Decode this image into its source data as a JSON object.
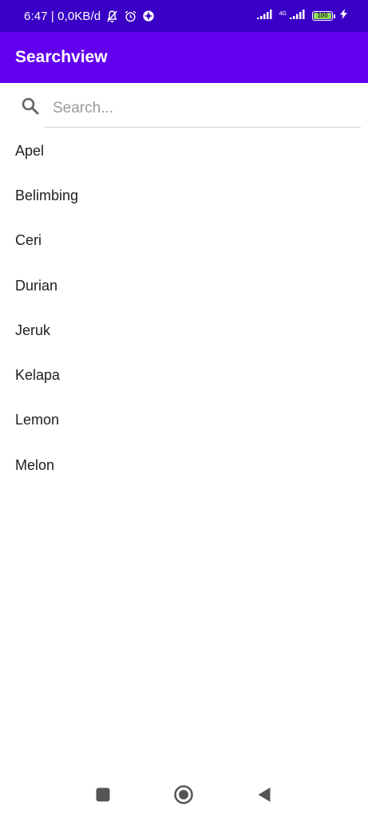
{
  "status_bar": {
    "time_speed": "6:47 | 0,0KB/d",
    "network_label": "4G",
    "battery_level": "100",
    "battery_percent": 100,
    "icons": [
      "mute-notifications-icon",
      "alarm-icon",
      "app-notification-icon",
      "signal-icon",
      "signal-4g-icon",
      "battery-icon",
      "charging-icon"
    ]
  },
  "app_bar": {
    "title": "Searchview"
  },
  "search": {
    "placeholder": "Search...",
    "value": ""
  },
  "fruits": [
    "Apel",
    "Belimbing",
    "Ceri",
    "Durian",
    "Jeruk",
    "Kelapa",
    "Lemon",
    "Melon"
  ],
  "nav": {
    "icons": [
      "recents-square-icon",
      "home-circle-icon",
      "back-triangle-icon"
    ]
  },
  "colors": {
    "status_bar": "#3a00c6",
    "app_bar": "#6200ee",
    "text": "#202020",
    "placeholder": "#9a9a9a",
    "battery": "#8fe05a"
  }
}
